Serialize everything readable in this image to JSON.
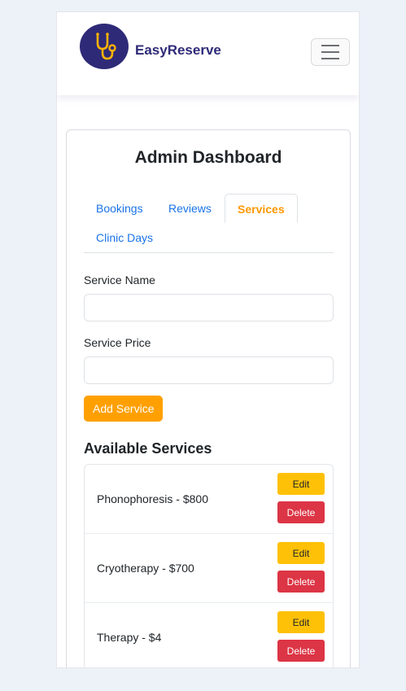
{
  "brand": {
    "name": "EasyReserve",
    "logo_icon": "stethoscope-icon"
  },
  "navbar": {
    "toggler_icon": "hamburger-menu-icon"
  },
  "dashboard": {
    "title": "Admin Dashboard"
  },
  "tabs": [
    {
      "label": "Bookings",
      "active": false
    },
    {
      "label": "Reviews",
      "active": false
    },
    {
      "label": "Services",
      "active": true
    },
    {
      "label": "Clinic Days",
      "active": false
    }
  ],
  "form": {
    "service_name_label": "Service Name",
    "service_name_value": "",
    "service_price_label": "Service Price",
    "service_price_value": "",
    "add_button": "Add Service"
  },
  "services": {
    "title": "Available Services",
    "edit_label": "Edit",
    "delete_label": "Delete",
    "items": [
      {
        "label": "Phonophoresis - $800"
      },
      {
        "label": "Cryotherapy - $700"
      },
      {
        "label": "Therapy - $4"
      }
    ]
  },
  "colors": {
    "brand": "#2e2a78",
    "accent": "#ffa000",
    "link": "#1a73e8",
    "edit": "#ffc107",
    "delete": "#dc3545"
  }
}
